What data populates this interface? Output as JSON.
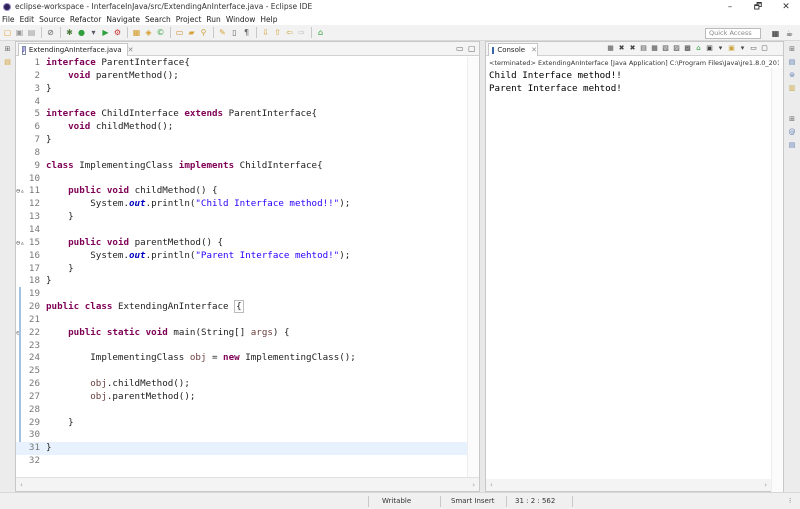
{
  "window": {
    "title": "eclipse-workspace - InterfaceInJava/src/ExtendingAnInterface.java - Eclipse IDE",
    "minimize": "–",
    "maximize": "🗗",
    "close": "✕"
  },
  "menu": [
    "File",
    "Edit",
    "Source",
    "Refactor",
    "Navigate",
    "Search",
    "Project",
    "Run",
    "Window",
    "Help"
  ],
  "toolbar": {
    "quick_access_placeholder": "Quick Access"
  },
  "editor": {
    "tab_label": "ExtendingAnInterface.java",
    "tab_close": "✕",
    "file_icon_text": "J",
    "active_line": 31,
    "lines": [
      {
        "n": "1",
        "fold": "",
        "tokens": [
          [
            "kw",
            "interface"
          ],
          [
            "",
            ""
          ],
          [
            "",
            "ParentInterface{"
          ]
        ]
      },
      {
        "n": "2",
        "fold": "",
        "tokens": [
          [
            "",
            "    "
          ],
          [
            "kw",
            "void"
          ],
          [
            "",
            " parentMethod();"
          ]
        ]
      },
      {
        "n": "3",
        "fold": "",
        "tokens": [
          [
            "",
            "}"
          ]
        ]
      },
      {
        "n": "4",
        "fold": "",
        "tokens": []
      },
      {
        "n": "5",
        "fold": "",
        "tokens": [
          [
            "kw",
            "interface"
          ],
          [
            "",
            " ChildInterface "
          ],
          [
            "kw",
            "extends"
          ],
          [
            "",
            " ParentInterface{"
          ]
        ]
      },
      {
        "n": "6",
        "fold": "",
        "tokens": [
          [
            "",
            "    "
          ],
          [
            "kw",
            "void"
          ],
          [
            "",
            " childMethod();"
          ]
        ]
      },
      {
        "n": "7",
        "fold": "",
        "tokens": [
          [
            "",
            "}"
          ]
        ]
      },
      {
        "n": "8",
        "fold": "",
        "tokens": []
      },
      {
        "n": "9",
        "fold": "",
        "tokens": [
          [
            "kw",
            "class"
          ],
          [
            "",
            " ImplementingClass "
          ],
          [
            "kw",
            "implements"
          ],
          [
            "",
            " ChildInterface{"
          ]
        ]
      },
      {
        "n": "10",
        "fold": "",
        "tokens": []
      },
      {
        "n": "11",
        "fold": "⊖▵",
        "tokens": [
          [
            "",
            "    "
          ],
          [
            "kw",
            "public"
          ],
          [
            "",
            ""
          ],
          [
            "kw",
            "void"
          ],
          [
            "",
            " childMethod() {"
          ]
        ]
      },
      {
        "n": "12",
        "fold": "",
        "tokens": [
          [
            "",
            "        System."
          ],
          [
            "sf",
            "out"
          ],
          [
            "",
            ".println("
          ],
          [
            "str",
            "\"Child Interface method!!\""
          ],
          [
            "",
            ");"
          ]
        ]
      },
      {
        "n": "13",
        "fold": "",
        "tokens": [
          [
            "",
            "    }"
          ]
        ]
      },
      {
        "n": "14",
        "fold": "",
        "tokens": []
      },
      {
        "n": "15",
        "fold": "⊖▵",
        "tokens": [
          [
            "",
            "    "
          ],
          [
            "kw",
            "public"
          ],
          [
            "",
            ""
          ],
          [
            "kw",
            "void"
          ],
          [
            "",
            " parentMethod() {"
          ]
        ]
      },
      {
        "n": "16",
        "fold": "",
        "tokens": [
          [
            "",
            "        System."
          ],
          [
            "sf",
            "out"
          ],
          [
            "",
            ".println("
          ],
          [
            "str",
            "\"Parent Interface mehtod!\""
          ],
          [
            "",
            ");"
          ]
        ]
      },
      {
        "n": "17",
        "fold": "",
        "tokens": [
          [
            "",
            "    }"
          ]
        ]
      },
      {
        "n": "18",
        "fold": "",
        "tokens": [
          [
            "",
            "}"
          ]
        ]
      },
      {
        "n": "19",
        "fold": "",
        "tokens": []
      },
      {
        "n": "20",
        "fold": "",
        "tokens": [
          [
            "kw",
            "public"
          ],
          [
            "",
            ""
          ],
          [
            "kw",
            "class"
          ],
          [
            "",
            " ExtendingAnInterface "
          ],
          [
            "brace",
            "{"
          ]
        ]
      },
      {
        "n": "21",
        "fold": "",
        "tokens": []
      },
      {
        "n": "22",
        "fold": "⊖",
        "tokens": [
          [
            "",
            "    "
          ],
          [
            "kw",
            "public"
          ],
          [
            "",
            ""
          ],
          [
            "kw",
            "static"
          ],
          [
            "",
            ""
          ],
          [
            "kw",
            "void"
          ],
          [
            "",
            " main(String[] "
          ],
          [
            "var",
            "args"
          ],
          [
            "",
            ") {"
          ]
        ]
      },
      {
        "n": "23",
        "fold": "",
        "tokens": []
      },
      {
        "n": "24",
        "fold": "",
        "tokens": [
          [
            "",
            "        ImplementingClass "
          ],
          [
            "var",
            "obj"
          ],
          [
            "",
            " = "
          ],
          [
            "kw",
            "new"
          ],
          [
            "",
            " ImplementingClass();"
          ]
        ]
      },
      {
        "n": "25",
        "fold": "",
        "tokens": []
      },
      {
        "n": "26",
        "fold": "",
        "tokens": [
          [
            "",
            "        "
          ],
          [
            "var",
            "obj"
          ],
          [
            "",
            ".childMethod();"
          ]
        ]
      },
      {
        "n": "27",
        "fold": "",
        "tokens": [
          [
            "",
            "        "
          ],
          [
            "var",
            "obj"
          ],
          [
            "",
            ".parentMethod();"
          ]
        ]
      },
      {
        "n": "28",
        "fold": "",
        "tokens": []
      },
      {
        "n": "29",
        "fold": "",
        "tokens": [
          [
            "",
            "    }"
          ]
        ]
      },
      {
        "n": "30",
        "fold": "",
        "tokens": []
      },
      {
        "n": "31",
        "fold": "",
        "tokens": [
          [
            "",
            "}"
          ]
        ]
      },
      {
        "n": "32",
        "fold": "",
        "tokens": []
      }
    ]
  },
  "console": {
    "tab_label": "Console",
    "tab_close": "✕",
    "status": "<terminated> ExtendingAnInterface [Java Application] C:\\Program Files\\Java\\jre1.8.0_201\\bin\\",
    "output": [
      "Child Interface method!!",
      "Parent Interface mehtod!"
    ]
  },
  "statusbar": {
    "mode": "Writable",
    "insert": "Smart Insert",
    "position": "31 : 2 : 562"
  },
  "colors": {
    "keyword": "#7f0055",
    "string": "#2a00ff",
    "static_field": "#0000c0",
    "local_var": "#6a3e3e",
    "active_line_bg": "#e8f2fe"
  }
}
